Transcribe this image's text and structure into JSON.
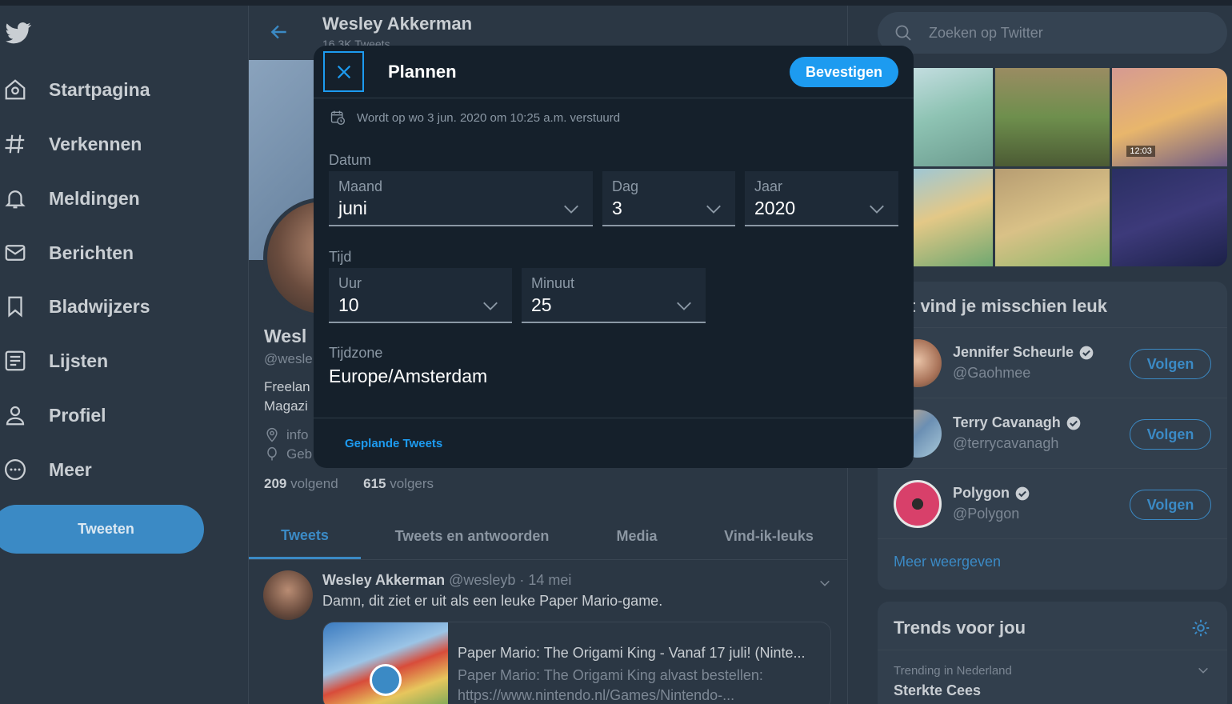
{
  "nav": {
    "items": [
      {
        "label": "Startpagina",
        "icon": "home-icon"
      },
      {
        "label": "Verkennen",
        "icon": "hashtag-icon"
      },
      {
        "label": "Meldingen",
        "icon": "bell-icon"
      },
      {
        "label": "Berichten",
        "icon": "mail-icon"
      },
      {
        "label": "Bladwijzers",
        "icon": "bookmark-icon"
      },
      {
        "label": "Lijsten",
        "icon": "list-icon"
      },
      {
        "label": "Profiel",
        "icon": "person-icon"
      },
      {
        "label": "Meer",
        "icon": "more-icon"
      }
    ],
    "tweet_button": "Tweeten"
  },
  "profile": {
    "header_name": "Wesley Akkerman",
    "header_tweets": "16,3K Tweets",
    "name_partial": "Wesl",
    "handle_partial": "@wesle",
    "bio_line1": "Freelan",
    "bio_line2": "Magazi",
    "meta_link": "info",
    "meta_born": "Geb",
    "following_count": "209",
    "following_label": "volgend",
    "followers_count": "615",
    "followers_label": "volgers",
    "tabs": [
      "Tweets",
      "Tweets en antwoorden",
      "Media",
      "Vind-ik-leuks"
    ]
  },
  "tweet": {
    "author": "Wesley Akkerman",
    "handle_date": "@wesleyb · 14 mei",
    "text": "Damn, dit ziet er uit als een leuke Paper Mario-game.",
    "card_title": "Paper Mario: The Origami King - Vanaf 17 juli! (Ninte...",
    "card_desc_line1": "Paper Mario: The Origami King alvast bestellen:",
    "card_desc_line2": "https://www.nintendo.nl/Games/Nintendo-..."
  },
  "right": {
    "search_placeholder": "Zoeken op Twitter",
    "suggest_title": "t vind je misschien leuk",
    "suggestions": [
      {
        "name": "Jennifer Scheurle",
        "handle": "@Gaohmee",
        "button": "Volgen"
      },
      {
        "name": "Terry Cavanagh",
        "handle": "@terrycavanagh",
        "button": "Volgen"
      },
      {
        "name": "Polygon",
        "handle": "@Polygon",
        "button": "Volgen"
      }
    ],
    "more_link": "Meer weergeven",
    "trends_title": "Trends voor jou",
    "trend_context": "Trending in Nederland",
    "trend_name": "Sterkte Cees",
    "media_time": "12:03"
  },
  "modal": {
    "title": "Plannen",
    "confirm": "Bevestigen",
    "schedule_info": "Wordt op wo 3 jun. 2020 om 10:25 a.m. verstuurd",
    "date_label": "Datum",
    "month_label": "Maand",
    "month_value": "juni",
    "day_label": "Dag",
    "day_value": "3",
    "year_label": "Jaar",
    "year_value": "2020",
    "time_label": "Tijd",
    "hour_label": "Uur",
    "hour_value": "10",
    "minute_label": "Minuut",
    "minute_value": "25",
    "timezone_label": "Tijdzone",
    "timezone_value": "Europe/Amsterdam",
    "scheduled_link": "Geplande Tweets"
  },
  "colors": {
    "accent": "#1d9bf0",
    "background": "#2b3744",
    "modal": "#15202b"
  }
}
